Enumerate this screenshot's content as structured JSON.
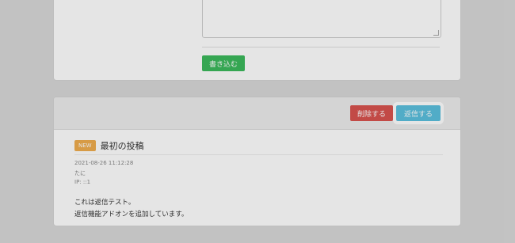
{
  "form": {
    "submit_label": "書き込む"
  },
  "post": {
    "delete_label": "削除する",
    "reply_label": "返信する",
    "badge": "NEW",
    "title": "最初の投稿",
    "datetime": "2021-08-26 11:12:28",
    "author": "たに",
    "ip": "IP: ::1",
    "body": [
      "これは返信テスト。",
      "返信機能アドオンを追加しています。"
    ]
  }
}
